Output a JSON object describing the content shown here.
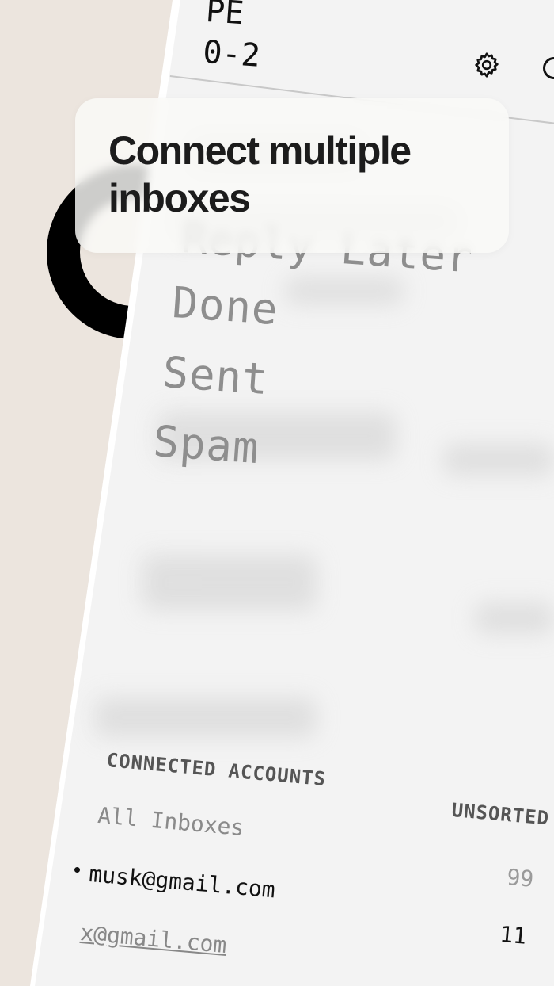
{
  "overlay": {
    "title": "Connect multiple inboxes"
  },
  "header": {
    "code_line1": "PE",
    "code_line2": "0-2"
  },
  "icons": {
    "settings": "gear-icon",
    "partial": "circle-icon"
  },
  "folders": [
    {
      "label": "Reply Later"
    },
    {
      "label": "Done"
    },
    {
      "label": "Sent"
    },
    {
      "label": "Spam"
    }
  ],
  "accounts": {
    "section_title": "CONNECTED ACCOUNTS",
    "unsorted_label": "UNSORTED",
    "items": [
      {
        "email": "All Inboxes",
        "count": ""
      },
      {
        "email": "musk@gmail.com",
        "count": "99"
      },
      {
        "email": "x@gmail.com",
        "count": "11"
      }
    ]
  },
  "colors": {
    "background": "#ece5de",
    "screen": "#f3f3f3",
    "ring": "#000000",
    "text": "#111111",
    "muted": "#8e8e8e"
  }
}
